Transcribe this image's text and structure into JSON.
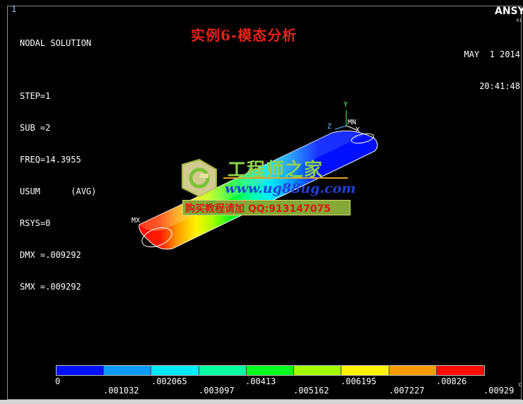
{
  "window": {
    "number": "1",
    "product": "ANSY",
    "product_sub": "R1",
    "date": "MAY  1 2014",
    "time": "20:41:48"
  },
  "title": "实例6-模态分析",
  "solution_info": [
    "NODAL SOLUTION",
    "",
    "STEP=1",
    "SUB =2",
    "FREQ=14.3955",
    "USUM      (AVG)",
    "RSYS=0",
    "DMX =.009292",
    "SMX =.009292"
  ],
  "model": {
    "max_label": "MX",
    "min_label": "MN",
    "axis_y": "Y",
    "axis_z": "Z",
    "axis_x": "X"
  },
  "watermark": {
    "brand_cn": "工程师之家",
    "url": "www.ug88ug.com",
    "contact": "购买教程请加 QQ:913147075"
  },
  "legend": {
    "colors": [
      "#0010ff",
      "#0a9cff",
      "#00e9ff",
      "#00ffa2",
      "#00ff1d",
      "#a4ff00",
      "#fff400",
      "#ff9a00",
      "#ff0a00"
    ],
    "ticks_top": [
      "0",
      ".002065",
      ".00413",
      ".006195",
      ".00826"
    ],
    "ticks_bottom": [
      ".001032",
      ".003097",
      ".005162",
      ".007227",
      ".00929"
    ]
  },
  "edge_text": "c"
}
